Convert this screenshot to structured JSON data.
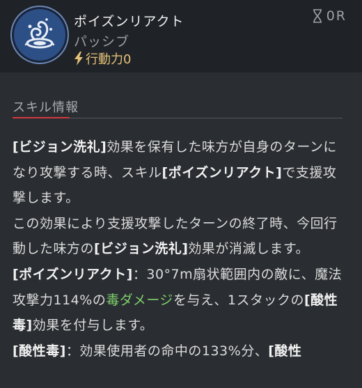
{
  "skill": {
    "name": "ポイズンリアクト",
    "type": "パッシブ",
    "ap_label": "行動力0",
    "cost_value": "0R",
    "icon": "poison-swirl-icon",
    "bolt_icon": "lightning-icon",
    "cost_icon": "hourglass-icon"
  },
  "section": {
    "title": "スキル情報"
  },
  "description": {
    "p1_a": "[ビジョン洗礼]",
    "p1_b": "効果を保有した味方が自身のターンになり攻撃する時、スキル",
    "p1_c": "[ポイズンリアクト]",
    "p1_d": "で支援攻撃します。",
    "p2_a": "この効果により支援攻撃したターンの終了時、今回行動した味方の",
    "p2_b": "[ビジョン洗礼]",
    "p2_c": "効果が消滅します。",
    "p3_a": "[ポイズンリアクト]",
    "p3_b": "：30°7m扇状範囲内の敵に、魔法攻撃力114%の",
    "p3_c": "毒ダメージ",
    "p3_d": "を与え、1スタックの",
    "p3_e": "[酸性毒]",
    "p3_f": "効果を付与します。",
    "p4_a": "[酸性毒]",
    "p4_b": "：効果使用者の命中の133%分、",
    "p4_c": "[酸性"
  },
  "colors": {
    "background": "#2a2d31",
    "header_bg": "#1f2226",
    "accent_red": "#d2393f",
    "ap_yellow": "#e5c27a",
    "damage_green": "#7fd06d"
  }
}
